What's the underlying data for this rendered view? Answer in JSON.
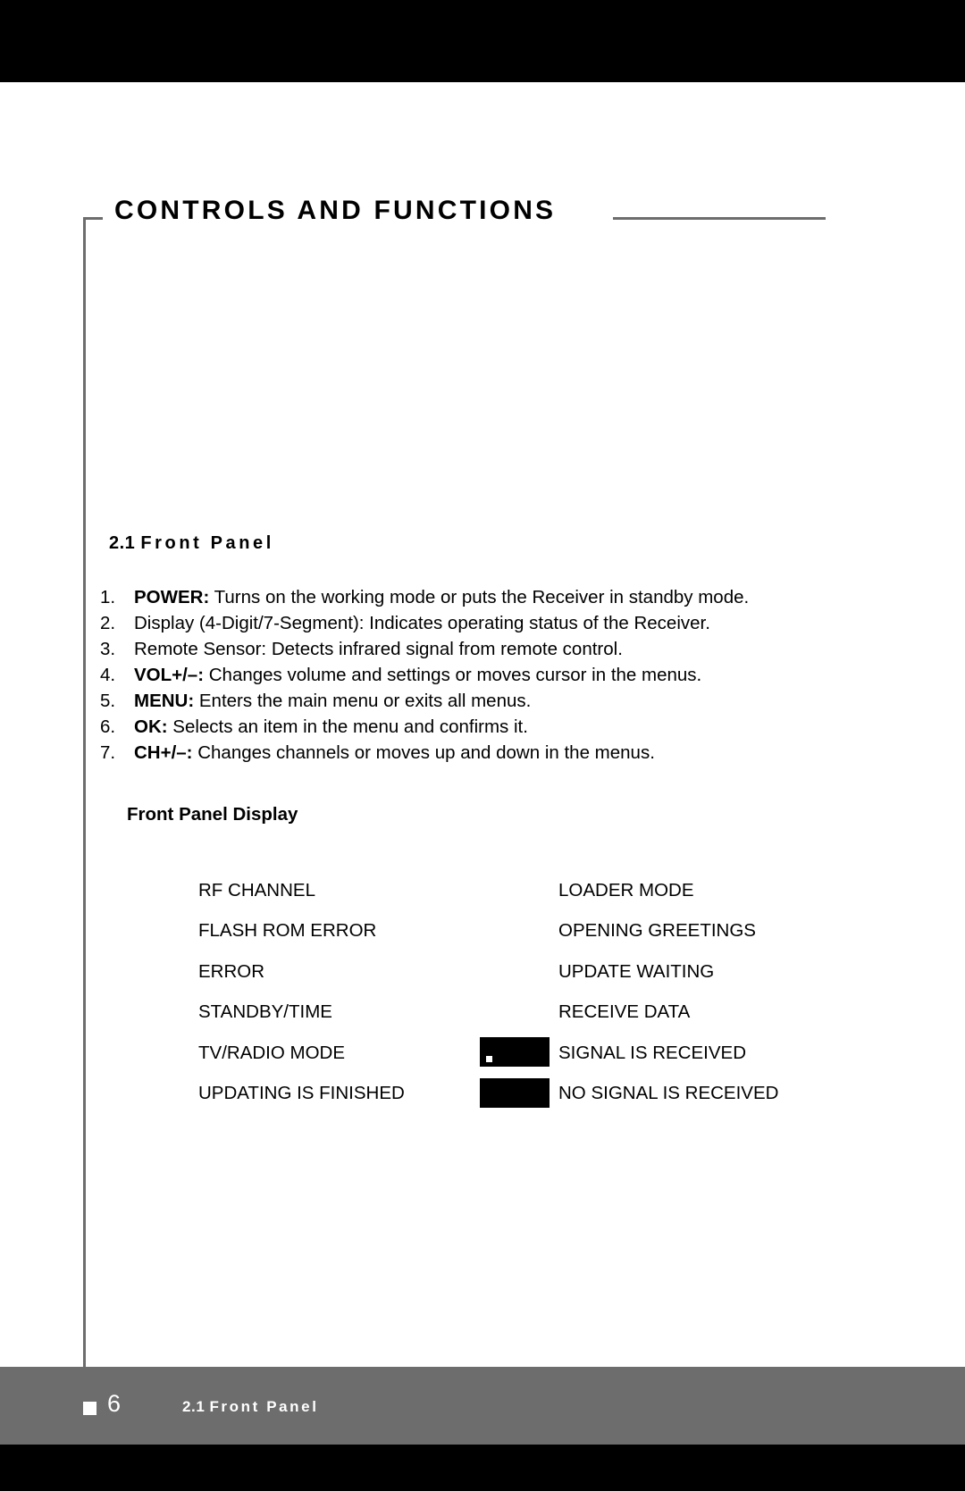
{
  "header": {
    "chapter_title": "CONTROLS AND FUNCTIONS"
  },
  "section": {
    "number": "2.1",
    "name": "Front Panel"
  },
  "controls_list": [
    {
      "index": "1.",
      "term": "POWER:",
      "description": " Turns on the working mode or puts the Receiver in standby mode."
    },
    {
      "index": "2.",
      "term": "",
      "description": "Display (4-Digit/7-Segment): Indicates operating status of the Receiver."
    },
    {
      "index": "3.",
      "term": "",
      "description": "Remote Sensor: Detects infrared signal from remote control."
    },
    {
      "index": "4.",
      "term": "VOL+/–:",
      "description": " Changes volume and settings or moves cursor in the menus."
    },
    {
      "index": "5.",
      "term": "MENU:",
      "description": " Enters the main menu or exits all menus."
    },
    {
      "index": "6.",
      "term": "OK:",
      "description": " Selects an item in the menu and confirms it."
    },
    {
      "index": "7.",
      "term": "CH+/–:",
      "description": " Changes channels or moves up and down in the menus."
    }
  ],
  "front_panel_display": {
    "heading": "Front Panel Display",
    "rows": [
      {
        "left": "RF CHANNEL",
        "right": "LOADER MODE",
        "swatch": "none"
      },
      {
        "left": "FLASH ROM ERROR",
        "right": "OPENING GREETINGS",
        "swatch": "none"
      },
      {
        "left": "ERROR",
        "right": "UPDATE WAITING",
        "swatch": "none"
      },
      {
        "left": "STANDBY/TIME",
        "right": "RECEIVE DATA",
        "swatch": "none"
      },
      {
        "left": "TV/RADIO MODE",
        "right": "SIGNAL IS RECEIVED",
        "swatch": "dot"
      },
      {
        "left": "UPDATING IS FINISHED",
        "right": "NO SIGNAL IS RECEIVED",
        "swatch": "solid"
      }
    ]
  },
  "footer": {
    "page_number": "6",
    "section_number": "2.1",
    "section_name": "Front Panel"
  },
  "colors": {
    "bar_black": "#000000",
    "rule_gray": "#6d6d6d",
    "text_black": "#000000",
    "footer_text": "#ffffff"
  }
}
